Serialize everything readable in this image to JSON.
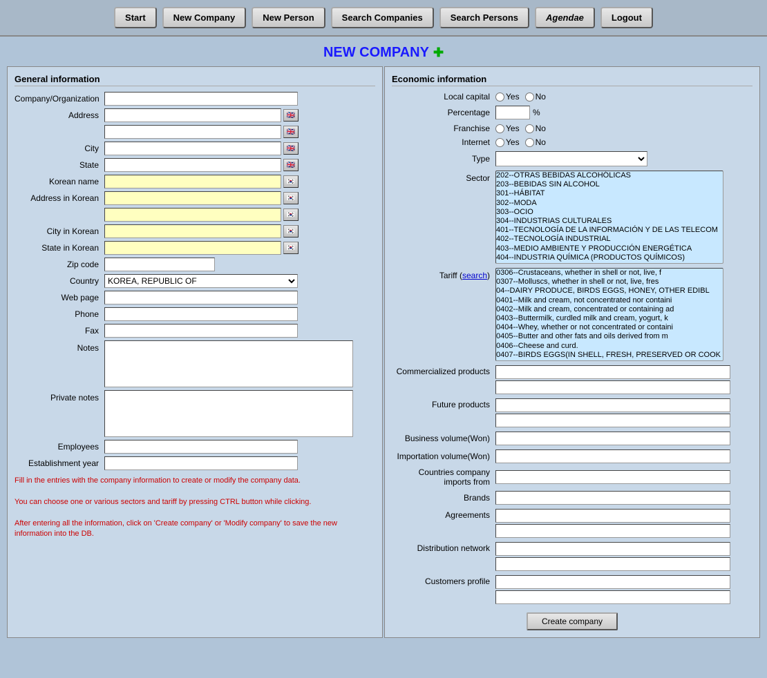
{
  "nav": {
    "start": "Start",
    "new_company": "New Company",
    "new_person": "New Person",
    "search_companies": "Search Companies",
    "search_persons": "Search Persons",
    "agendae": "Agendae",
    "logout": "Logout"
  },
  "page": {
    "title": "NEW COMPANY",
    "plus": "✚"
  },
  "left": {
    "section_title": "General information",
    "fields": {
      "company_org": "Company/Organization",
      "address": "Address",
      "city": "City",
      "state": "State",
      "korean_name": "Korean name",
      "address_korean": "Address in Korean",
      "city_korean": "City in Korean",
      "state_korean": "State in Korean",
      "zip_code": "Zip code",
      "country": "Country",
      "web_page": "Web page",
      "phone": "Phone",
      "fax": "Fax",
      "notes": "Notes",
      "private_notes": "Private notes",
      "employees": "Employees",
      "establishment_year": "Establishment year"
    },
    "country_value": "KOREA, REPUBLIC OF",
    "hints": [
      "Fill in the entries with the company information to create or modify the company data.",
      "You can choose one or various sectors and tariff by pressing CTRL button while clicking.",
      "After entering all the information, click on 'Create company' or 'Modify company' to save the new information into the DB."
    ]
  },
  "right": {
    "section_title": "Economic information",
    "local_capital_label": "Local capital",
    "yes_label": "Yes",
    "no_label": "No",
    "percentage_label": "Percentage",
    "pct_symbol": "%",
    "franchise_label": "Franchise",
    "internet_label": "Internet",
    "type_label": "Type",
    "sector_label": "Sector",
    "tariff_label": "Tariff",
    "tariff_search": "search",
    "commercialized_label": "Commercialized products",
    "future_label": "Future products",
    "business_volume_label": "Business volume(Won)",
    "importation_label": "Importation volume(Won)",
    "countries_label": "Countries company imports from",
    "brands_label": "Brands",
    "agreements_label": "Agreements",
    "distribution_label": "Distribution network",
    "customers_label": "Customers profile",
    "sector_options": [
      "202--OTRAS BEBIDAS ALCOHÓLICAS",
      "203--BEBIDAS SIN ALCOHOL",
      "301--HÁBITAT",
      "302--MODA",
      "303--OCIO",
      "304--INDUSTRIAS CULTURALES",
      "401--TECNOLOGÍA DE LA INFORMACIÓN Y DE LAS TELECOM",
      "402--TECNOLOGÍA INDUSTRIAL",
      "403--MEDIO AMBIENTE Y PRODUCCIÓN ENERGÉTICA",
      "404--INDUSTRIA QUÍMICA (PRODUCTOS QUÍMICOS)"
    ],
    "tariff_options": [
      "0306--Crustaceans, whether in shell or not, live, f",
      "0307--Molluscs, whether in shell or not, live, fres",
      "04--DAIRY PRODUCE, BIRDS EGGS, HONEY, OTHER EDIBL",
      "0401--Milk and cream, not concentrated nor containi",
      "0402--Milk and cream, concentrated or containing ad",
      "0403--Buttermilk, curdled milk and cream, yogurt, k",
      "0404--Whey, whether or not concentrated or containi",
      "0405--Butter and other fats and oils derived from m",
      "0406--Cheese and curd.",
      "0407--BIRDS EGGS(IN SHELL, FRESH, PRESERVED OR COOK"
    ],
    "create_btn": "Create company"
  }
}
